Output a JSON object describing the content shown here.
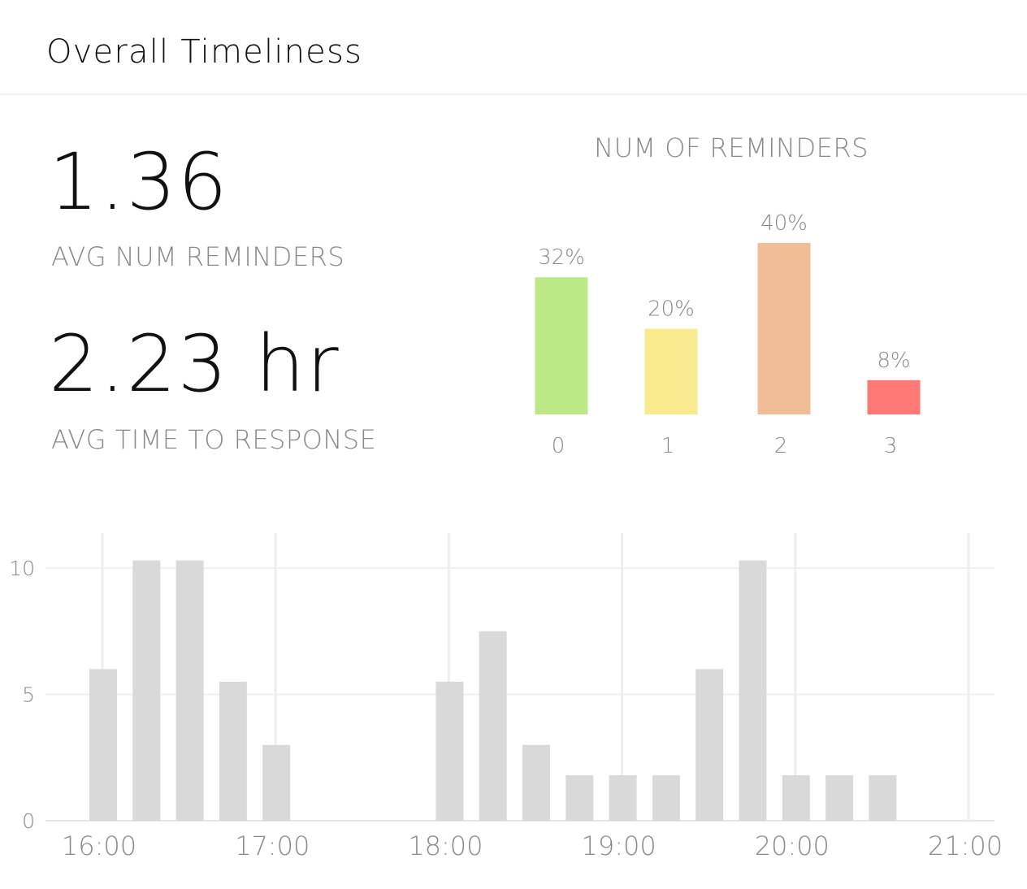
{
  "header": {
    "title": "Overall Timeliness"
  },
  "kpis": [
    {
      "value": "1.36",
      "label": "AVG NUM REMINDERS"
    },
    {
      "value": "2.23 hr",
      "label": "AVG TIME TO RESPONSE"
    }
  ],
  "chart_data": [
    {
      "type": "bar",
      "title": "NUM OF REMINDERS",
      "categories": [
        "0",
        "1",
        "2",
        "3"
      ],
      "values": [
        32,
        20,
        40,
        8
      ],
      "data_labels": [
        "32%",
        "20%",
        "40%",
        "8%"
      ],
      "colors": [
        "#bde886",
        "#f7ea8f",
        "#f0bd96",
        "#ff7a76"
      ],
      "ylim": [
        0,
        40
      ],
      "grid": false
    },
    {
      "type": "bar",
      "x_ticks": [
        "16:00",
        "17:00",
        "18:00",
        "19:00",
        "20:00",
        "21:00"
      ],
      "y_ticks": [
        "0",
        "5",
        "10"
      ],
      "ylim": [
        0,
        10
      ],
      "grid": true,
      "bar_color": "#d9d9d9",
      "x": [
        "16:00",
        "16:15",
        "16:30",
        "16:45",
        "17:00",
        "18:00",
        "18:15",
        "18:30",
        "18:45",
        "19:00",
        "19:15",
        "19:30",
        "19:45",
        "20:00",
        "20:15",
        "20:30"
      ],
      "values": [
        6,
        10.3,
        10.3,
        5.5,
        3,
        5.5,
        7.5,
        3,
        1.8,
        1.8,
        1.8,
        6,
        10.3,
        1.8,
        1.8,
        1.8
      ]
    }
  ]
}
